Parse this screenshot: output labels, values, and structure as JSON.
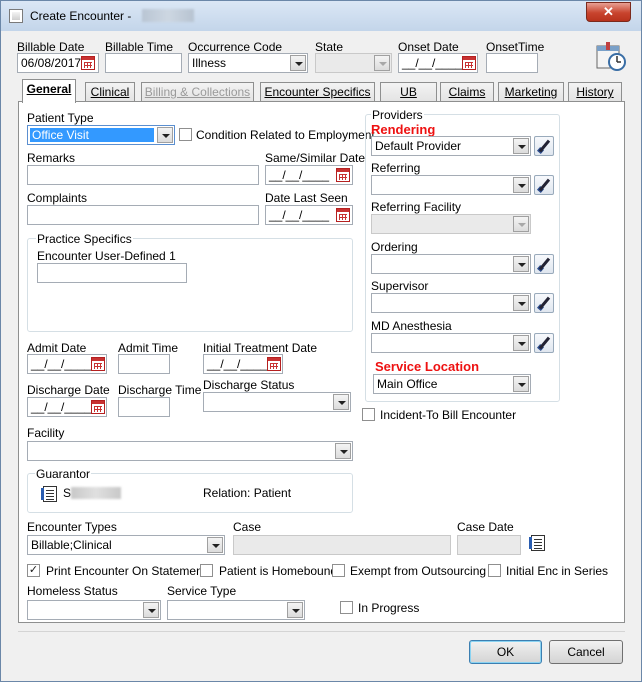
{
  "window": {
    "title": "Create Encounter -",
    "close_glyph": "✕"
  },
  "header": {
    "billable_date_label": "Billable Date",
    "billable_date_value": "06/08/2017",
    "billable_time_label": "Billable Time",
    "billable_time_value": "",
    "occurrence_code_label": "Occurrence Code",
    "occurrence_code_value": "Illness",
    "state_label": "State",
    "state_value": "",
    "onset_date_label": "Onset Date",
    "onset_date_value": "__/__/____",
    "onset_time_label": "OnsetTime",
    "onset_time_value": ""
  },
  "tabs": [
    {
      "label": "General"
    },
    {
      "label": "Clinical"
    },
    {
      "label": "Billing & Collections"
    },
    {
      "label": "Encounter Specifics"
    },
    {
      "label": "UB"
    },
    {
      "label": "Claims"
    },
    {
      "label": "Marketing"
    },
    {
      "label": "History"
    }
  ],
  "general": {
    "patient_type_label": "Patient Type",
    "patient_type_value": "Office Visit",
    "condition_employment_label": "Condition Related to Employment",
    "remarks_label": "Remarks",
    "remarks_value": "",
    "same_similar_date_label": "Same/Similar Date",
    "same_similar_date_value": "__/__/____",
    "complaints_label": "Complaints",
    "complaints_value": "",
    "date_last_seen_label": "Date Last Seen",
    "date_last_seen_value": "__/__/____",
    "practice_specifics_label": "Practice Specifics",
    "encounter_user_defined_label": "Encounter User-Defined 1",
    "encounter_user_defined_value": "",
    "admit_date_label": "Admit Date",
    "admit_date_value": "__/__/____",
    "admit_time_label": "Admit Time",
    "admit_time_value": "",
    "initial_treatment_label": "Initial Treatment Date",
    "initial_treatment_value": "__/__/____",
    "discharge_date_label": "Discharge Date",
    "discharge_date_value": "__/__/____",
    "discharge_time_label": "Discharge Time",
    "discharge_time_value": "",
    "discharge_status_label": "Discharge Status",
    "discharge_status_value": "",
    "facility_label": "Facility",
    "facility_value": "",
    "guarantor_label": "Guarantor",
    "guarantor_initial": "S",
    "relation_text": "Relation:  Patient",
    "encounter_types_label": "Encounter Types",
    "encounter_types_value": "Billable;Clinical",
    "case_label": "Case",
    "case_value": "",
    "case_date_label": "Case Date",
    "case_date_value": "",
    "print_statements_label": "Print Encounter On Statements",
    "print_statements_checked": "✓",
    "homebound_label": "Patient is Homebound",
    "exempt_outsourcing_label": "Exempt from Outsourcing",
    "initial_enc_series_label": "Initial Enc in Series",
    "homeless_status_label": "Homeless Status",
    "homeless_status_value": "",
    "service_type_label": "Service Type",
    "service_type_value": "",
    "in_progress_label": "In Progress"
  },
  "providers": {
    "group_label": "Providers",
    "rendering_label": "Rendering",
    "rendering_value": "Default Provider",
    "referring_label": "Referring",
    "referring_value": "",
    "referring_facility_label": "Referring Facility",
    "referring_facility_value": "",
    "ordering_label": "Ordering",
    "ordering_value": "",
    "supervisor_label": "Supervisor",
    "supervisor_value": "",
    "md_anesthesia_label": "MD Anesthesia",
    "md_anesthesia_value": "",
    "service_location_label": "Service Location",
    "service_location_value": "Main Office",
    "incident_to_label": "Incident-To Bill Encounter"
  },
  "footer": {
    "ok_label": "OK",
    "cancel_label": "Cancel"
  },
  "colors": {
    "required_label": "#e11111",
    "selection_highlight": "#3399ff"
  }
}
